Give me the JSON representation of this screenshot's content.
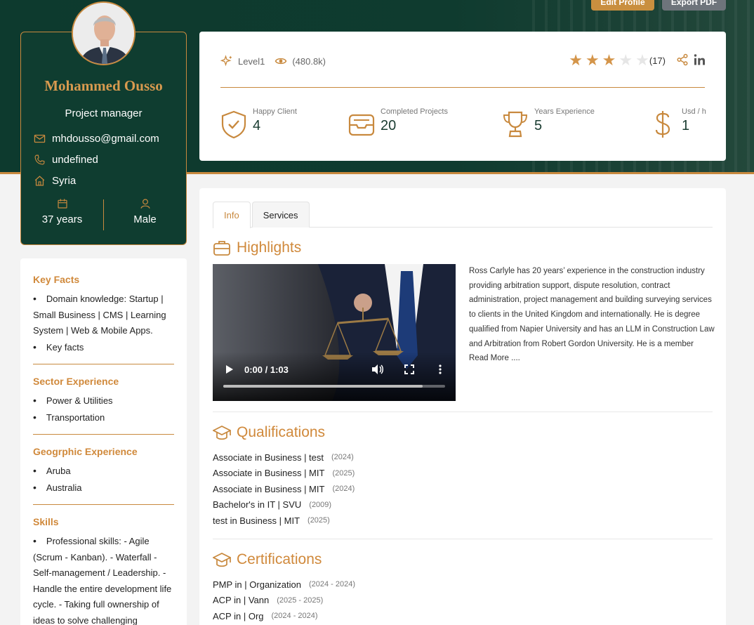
{
  "topbar": {
    "edit_label": "Edit Profile",
    "export_label": "Export PDF"
  },
  "profile": {
    "name": "Mohammed Ousso",
    "role": "Project manager",
    "email": "mhdousso@gmail.com",
    "phone": "undefined",
    "country": "Syria",
    "age": "37 years",
    "gender": "Male"
  },
  "stats": {
    "level": "Level1",
    "views": "(480.8k)",
    "rating_stars": 3,
    "rating_max": 5,
    "rating_count": "(17)",
    "items": [
      {
        "label": "Happy Client",
        "value": "4",
        "icon": "shield-check-icon"
      },
      {
        "label": "Completed Projects",
        "value": "20",
        "icon": "inbox-tray-icon"
      },
      {
        "label": "Years Experience",
        "value": "5",
        "icon": "trophy-icon"
      },
      {
        "label": "Usd / h",
        "value": "1",
        "icon": "dollar-icon"
      }
    ]
  },
  "left": {
    "key_facts_title": "Key Facts",
    "key_facts": [
      "Domain knowledge: Startup | Small Business | CMS | Learning System | Web & Mobile Apps.",
      "Key facts"
    ],
    "sector_title": "Sector Experience",
    "sectors": [
      "Power & Utilities",
      "Transportation"
    ],
    "geo_title": "Geogrphic Experience",
    "geos": [
      "Aruba",
      "Australia"
    ],
    "skills_title": "Skills",
    "skills": [
      "Professional skills: - Agile (Scrum - Kanban). - Waterfall - Self-management / Leadership. - Handle the entire development life cycle. - Taking full ownership of ideas to solve challenging"
    ]
  },
  "tabs": {
    "info": "Info",
    "services": "Services"
  },
  "highlights": {
    "title": "Highlights",
    "video_time": "0:00 / 1:03",
    "video_progress": 0.9,
    "description": "Ross Carlyle has 20 years’ experience in the construction industry providing arbitration support, dispute resolution, contract administration, project management and building surveying services to clients in the United Kingdom and internationally. He is degree qualified from Napier University and has an LLM in Construction Law and Arbitration from Robert Gordon University. He is a member Read More ...."
  },
  "qualifications": {
    "title": "Qualifications",
    "items": [
      {
        "name": "Associate in Business | test",
        "year": "(2024)"
      },
      {
        "name": "Associate in Business | MIT",
        "year": "(2025)"
      },
      {
        "name": "Associate in Business | MIT",
        "year": "(2024)"
      },
      {
        "name": "Bachelor's in IT | SVU",
        "year": "(2009)"
      },
      {
        "name": "test in Business | MIT",
        "year": "(2025)"
      }
    ]
  },
  "certifications": {
    "title": "Certifications",
    "items": [
      {
        "name": "PMP in | Organization",
        "year": "(2024 - 2024)"
      },
      {
        "name": "ACP in | Vann",
        "year": "(2025 - 2025)"
      },
      {
        "name": "ACP in | Org",
        "year": "(2024 - 2024)"
      }
    ]
  },
  "colors": {
    "brand_green": "#0f3d30",
    "accent_gold": "#c8893e",
    "star_gold": "#d4954a"
  }
}
